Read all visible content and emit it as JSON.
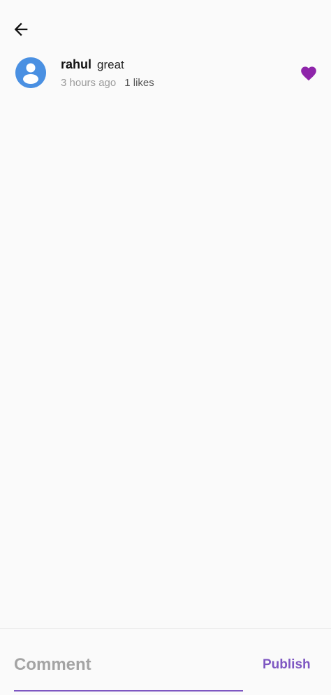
{
  "icons": {
    "back": "arrow-left-icon",
    "avatar": "user-avatar-icon",
    "like": "heart-icon"
  },
  "colors": {
    "background": "#fafafa",
    "accent": "#7e57c2",
    "heart": "#8e24aa",
    "avatar_bg": "#4a90e2"
  },
  "comments": [
    {
      "username": "rahul",
      "text": "great",
      "timestamp": "3 hours ago",
      "likes": "1 likes",
      "liked": true
    }
  ],
  "composer": {
    "placeholder": "Comment",
    "value": "",
    "publish_label": "Publish"
  }
}
